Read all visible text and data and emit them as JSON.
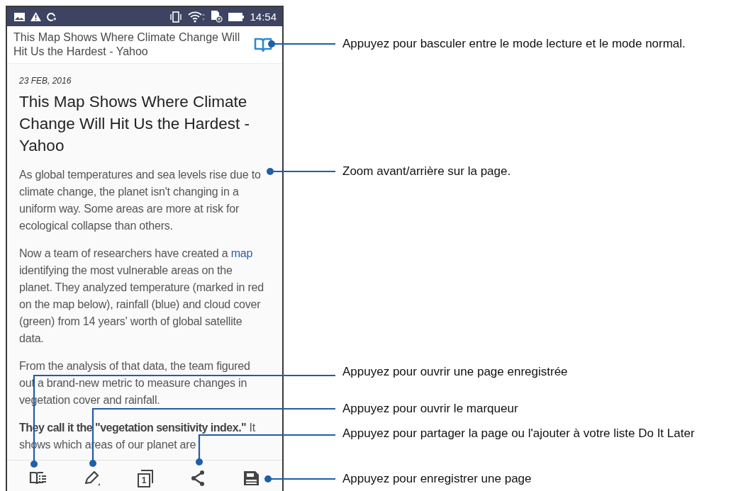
{
  "status_bar": {
    "time": "14:54"
  },
  "header": {
    "title": "This Map Shows Where Climate Change Will Hit Us the Hardest - Yahoo"
  },
  "article": {
    "date": "23 FEB, 2016",
    "title": "This Map Shows Where Climate Change Will Hit Us the Hardest - Yahoo",
    "paragraphs": [
      {
        "segments": [
          {
            "kind": "text",
            "text": "As global temperatures and sea levels rise due to climate change, the planet isn't changing in a uniform way. Some areas are more at risk for ecological collapse than others."
          }
        ]
      },
      {
        "segments": [
          {
            "kind": "text",
            "text": "Now a team of researchers have created a "
          },
          {
            "kind": "link",
            "text": "map"
          },
          {
            "kind": "text",
            "text": " identifying the most vulnerable areas on the planet. They analyzed temperature (marked in red on the map below), rainfall (blue) and cloud cover (green) from 14 years' worth of global satellite data."
          }
        ]
      },
      {
        "segments": [
          {
            "kind": "text",
            "text": "From the analysis of that data, the team figured out a brand-new metric to measure changes in vegetation cover and rainfall."
          }
        ]
      },
      {
        "segments": [
          {
            "kind": "text",
            "text": "**They call it the \"vegetation sensitivity index.\"** It shows which areas of our planet are"
          }
        ]
      }
    ]
  },
  "toolbar": [
    {
      "kind": "reading-list"
    },
    {
      "kind": "marker"
    },
    {
      "kind": "tabs",
      "text": "1"
    },
    {
      "kind": "share"
    },
    {
      "kind": "save"
    }
  ],
  "callouts": [
    {
      "text": "Appuyez pour basculer entre le mode lecture et le mode normal."
    },
    {
      "text": "Zoom avant/arrière sur la page."
    },
    {
      "text": "Appuyez pour ouvrir une page enregistrée"
    },
    {
      "text": "Appuyez pour ouvrir le marqueur"
    },
    {
      "text": "Appuyez pour partager la page ou l'ajouter à votre liste Do It Later"
    },
    {
      "text": "Appuyez pour enregistrer une page"
    }
  ]
}
